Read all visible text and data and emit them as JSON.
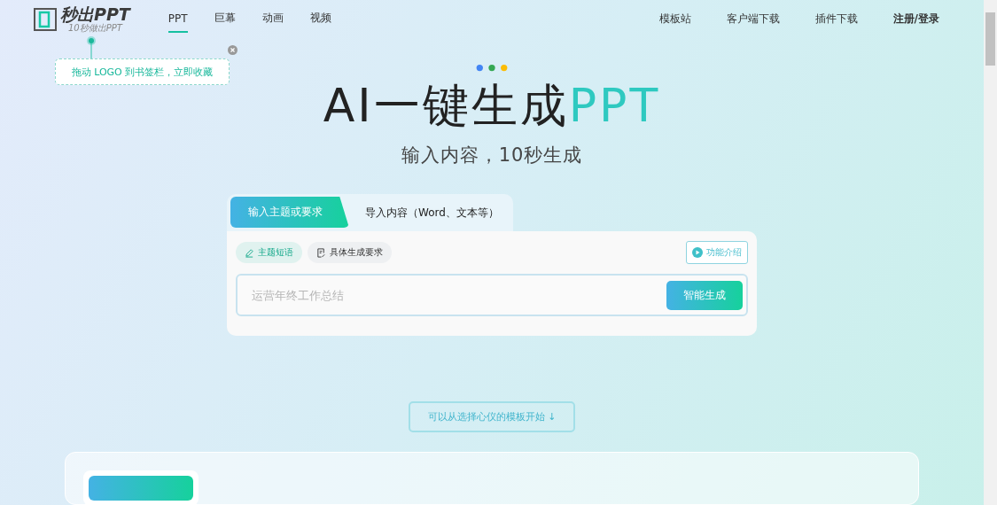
{
  "logo": {
    "name": "秒出PPT",
    "tagline": "10秒做出PPT"
  },
  "nav": [
    {
      "label": "PPT",
      "selected": true
    },
    {
      "label": "巨幕",
      "selected": false
    },
    {
      "label": "动画",
      "selected": false
    },
    {
      "label": "视频",
      "selected": false
    }
  ],
  "nav_right": [
    "模板站",
    "客户端下载",
    "插件下载"
  ],
  "auth": "注册/登录",
  "tooltip": {
    "text": "拖动 LOGO 到书签栏，立即收藏"
  },
  "hero": {
    "title": "AI一键生成",
    "title_accent": "PPT",
    "subtitle": "输入内容，10秒生成"
  },
  "tabs": [
    {
      "label": "输入主题或要求",
      "selected": true
    },
    {
      "label": "导入内容（Word、文本等）",
      "selected": false
    }
  ],
  "modes": [
    {
      "label": "主题短语",
      "selected": true,
      "kind": "pen"
    },
    {
      "label": "具体生成要求",
      "selected": false,
      "kind": "doc"
    }
  ],
  "intro_button": "功能介绍",
  "input": {
    "placeholder": "运营年终工作总结"
  },
  "generate_button": "智能生成",
  "template_hint": "可以从选择心仪的模板开始 ↓"
}
